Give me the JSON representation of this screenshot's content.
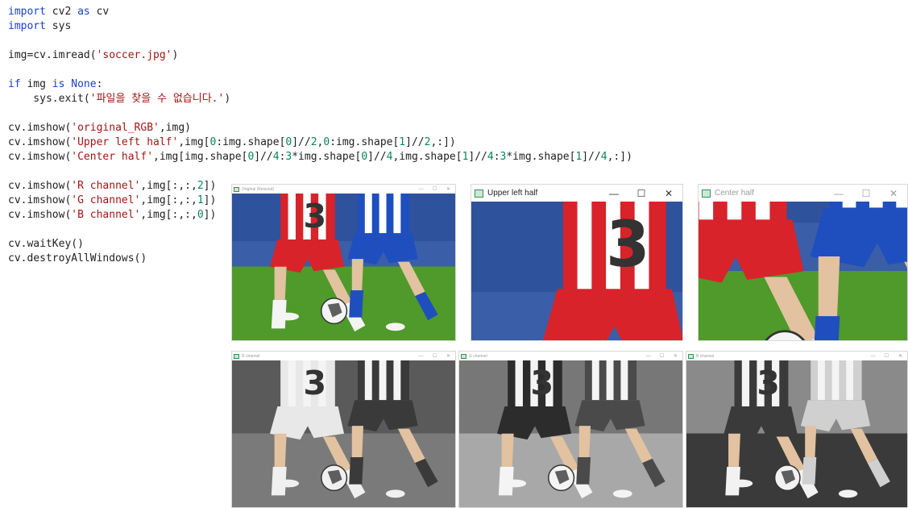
{
  "code_lines": [
    [
      {
        "t": "import",
        "c": "kw"
      },
      {
        "t": " cv2 "
      },
      {
        "t": "as",
        "c": "kw"
      },
      {
        "t": " cv"
      }
    ],
    [
      {
        "t": "import",
        "c": "kw"
      },
      {
        "t": " sys"
      }
    ],
    [],
    [
      {
        "t": "img=cv.imread("
      },
      {
        "t": "'soccer.jpg'",
        "c": "str"
      },
      {
        "t": ")"
      }
    ],
    [],
    [
      {
        "t": "if",
        "c": "kw"
      },
      {
        "t": " img "
      },
      {
        "t": "is None",
        "c": "kw"
      },
      {
        "t": ":"
      }
    ],
    [
      {
        "t": "    sys.exit("
      },
      {
        "t": "'파일을 찾을 수 없습니다.'",
        "c": "str"
      },
      {
        "t": ")"
      }
    ],
    [],
    [
      {
        "t": "cv.imshow("
      },
      {
        "t": "'original_RGB'",
        "c": "str"
      },
      {
        "t": ",img)"
      }
    ],
    [
      {
        "t": "cv.imshow("
      },
      {
        "t": "'Upper left half'",
        "c": "str"
      },
      {
        "t": ",img["
      },
      {
        "t": "0",
        "c": "num"
      },
      {
        "t": ":img.shape["
      },
      {
        "t": "0",
        "c": "num"
      },
      {
        "t": "]//"
      },
      {
        "t": "2",
        "c": "num"
      },
      {
        "t": ","
      },
      {
        "t": "0",
        "c": "num"
      },
      {
        "t": ":img.shape["
      },
      {
        "t": "1",
        "c": "num"
      },
      {
        "t": "]//"
      },
      {
        "t": "2",
        "c": "num"
      },
      {
        "t": ",:])"
      }
    ],
    [
      {
        "t": "cv.imshow("
      },
      {
        "t": "'Center half'",
        "c": "str"
      },
      {
        "t": ",img[img.shape["
      },
      {
        "t": "0",
        "c": "num"
      },
      {
        "t": "]//"
      },
      {
        "t": "4",
        "c": "num"
      },
      {
        "t": ":"
      },
      {
        "t": "3",
        "c": "num"
      },
      {
        "t": "*img.shape["
      },
      {
        "t": "0",
        "c": "num"
      },
      {
        "t": "]//"
      },
      {
        "t": "4",
        "c": "num"
      },
      {
        "t": ",img.shape["
      },
      {
        "t": "1",
        "c": "num"
      },
      {
        "t": "]//"
      },
      {
        "t": "4",
        "c": "num"
      },
      {
        "t": ":"
      },
      {
        "t": "3",
        "c": "num"
      },
      {
        "t": "*img.shape["
      },
      {
        "t": "1",
        "c": "num"
      },
      {
        "t": "]//"
      },
      {
        "t": "4",
        "c": "num"
      },
      {
        "t": ",:])"
      }
    ],
    [],
    [
      {
        "t": "cv.imshow("
      },
      {
        "t": "'R channel'",
        "c": "str"
      },
      {
        "t": ",img[:,:,"
      },
      {
        "t": "2",
        "c": "num"
      },
      {
        "t": "])"
      }
    ],
    [
      {
        "t": "cv.imshow("
      },
      {
        "t": "'G channel'",
        "c": "str"
      },
      {
        "t": ",img[:,:,"
      },
      {
        "t": "1",
        "c": "num"
      },
      {
        "t": "])"
      }
    ],
    [
      {
        "t": "cv.imshow("
      },
      {
        "t": "'B channel'",
        "c": "str"
      },
      {
        "t": ",img[:,:,"
      },
      {
        "t": "0",
        "c": "num"
      },
      {
        "t": "])"
      }
    ],
    [],
    [
      {
        "t": "cv.waitKey()"
      }
    ],
    [
      {
        "t": "cv.destroyAllWindows()"
      }
    ]
  ],
  "windows": [
    {
      "id": "original",
      "title": "Original (Resized)",
      "active": false,
      "small": true,
      "image": "color-full"
    },
    {
      "id": "upper-left",
      "title": "Upper left half",
      "active": true,
      "small": false,
      "image": "color-upper-left"
    },
    {
      "id": "center",
      "title": "Center half",
      "active": false,
      "small": false,
      "image": "color-center"
    },
    {
      "id": "r-channel",
      "title": "R channel",
      "active": false,
      "small": true,
      "image": "gray-r"
    },
    {
      "id": "g-channel",
      "title": "G channel",
      "active": false,
      "small": true,
      "image": "gray-g"
    },
    {
      "id": "b-channel",
      "title": "B channel",
      "active": false,
      "small": true,
      "image": "gray-b"
    }
  ],
  "controls": {
    "minimize": "—",
    "maximize": "☐",
    "close": "✕"
  },
  "icons": {
    "window": "opencv-window-icon"
  },
  "colors": {
    "keyword": "#1a3fc8",
    "string": "#a31515",
    "number": "#098658",
    "grass": "#4f9a2a",
    "red_kit": "#d8232a",
    "blue_kit": "#1f4fbf"
  }
}
